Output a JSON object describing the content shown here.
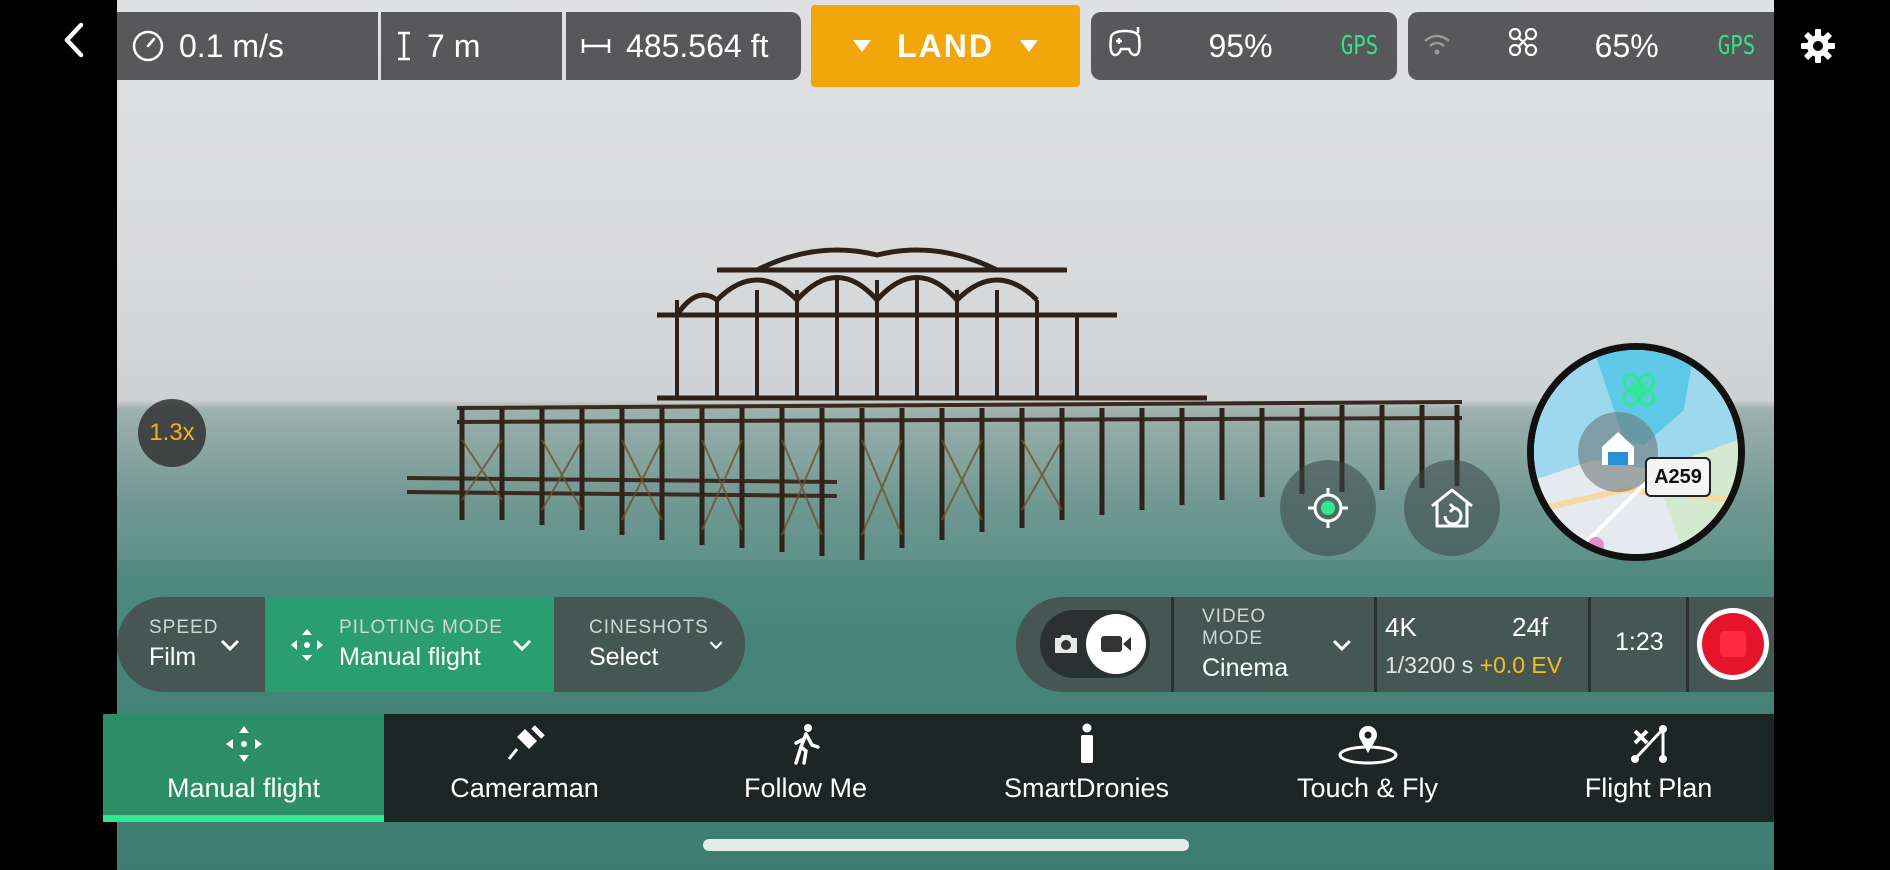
{
  "top_bar": {
    "back_icon": "chevron-left-icon",
    "speed": {
      "icon": "speedometer-icon",
      "value": "0.1 m/s"
    },
    "altitude": {
      "icon": "altitude-icon",
      "value": "7 m"
    },
    "distance": {
      "icon": "distance-icon",
      "value": "485.564 ft"
    },
    "land_label": "LAND",
    "controller": {
      "icon": "gamepad-icon",
      "battery": "95%",
      "gps": "GPS"
    },
    "drone": {
      "wifi_icon": "wifi-icon",
      "icon": "drone-icon",
      "battery": "65%",
      "gps": "GPS"
    },
    "settings_icon": "gear-icon",
    "gps_color": "#34e08a",
    "land_color": "#f1a70c"
  },
  "zoom": "1.3x",
  "map": {
    "road_label": "A259"
  },
  "controls_left": {
    "speed": {
      "label": "SPEED",
      "value": "Film"
    },
    "piloting": {
      "label": "PILOTING MODE",
      "value": "Manual flight"
    },
    "cineshots": {
      "label": "CINESHOTS",
      "value": "Select"
    }
  },
  "controls_right": {
    "video_mode": {
      "label": "VIDEO MODE",
      "value": "Cinema"
    },
    "resolution": "4K",
    "framerate": "24f",
    "shutter": "1/3200 s",
    "ev": "+0.0 EV",
    "timer": "1:23"
  },
  "modes": [
    {
      "label": "Manual flight",
      "icon": "move-arrows-icon",
      "active": true
    },
    {
      "label": "Cameraman",
      "icon": "camera-pen-icon",
      "active": false
    },
    {
      "label": "Follow Me",
      "icon": "walking-person-icon",
      "active": false
    },
    {
      "label": "SmartDronies",
      "icon": "person-icon",
      "active": false
    },
    {
      "label": "Touch & Fly",
      "icon": "location-pin-icon",
      "active": false
    },
    {
      "label": "Flight Plan",
      "icon": "flight-plan-icon",
      "active": false
    }
  ],
  "colors": {
    "active_mode": "#2b8e67",
    "record": "#e5142b",
    "ev": "#f3c018",
    "zoom": "#f3b21a"
  }
}
